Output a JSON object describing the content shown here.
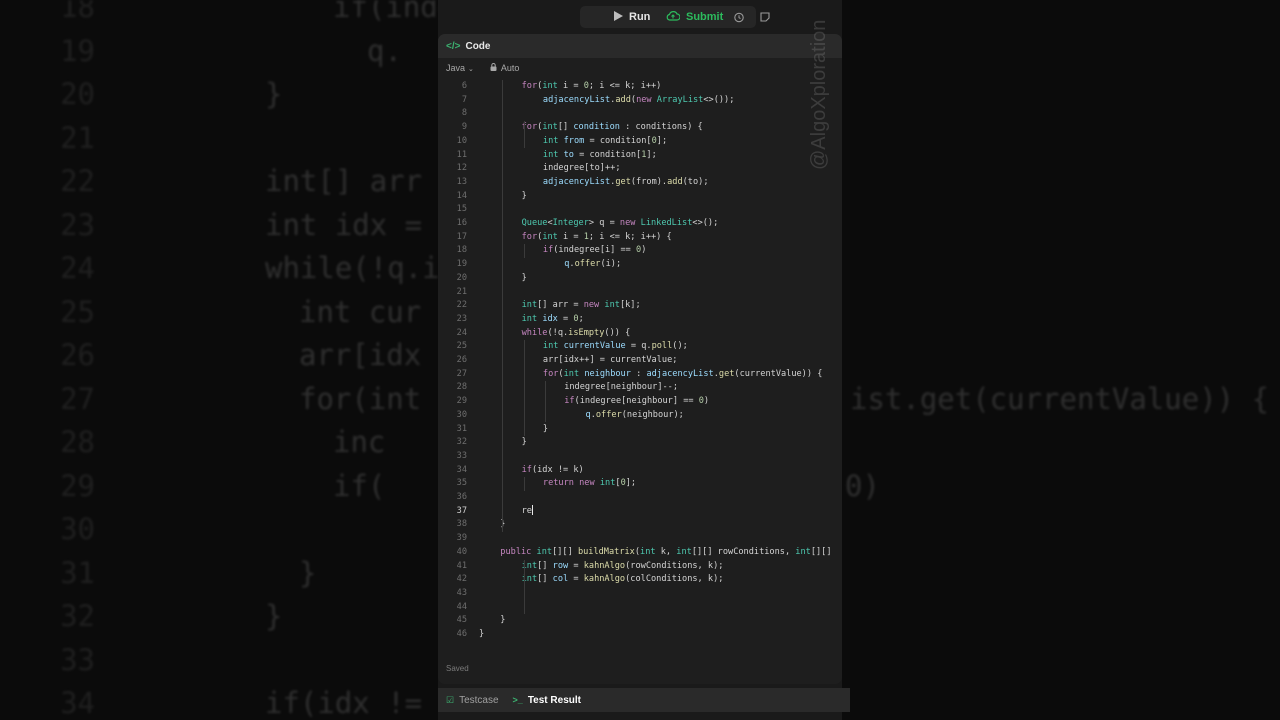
{
  "background": {
    "lines": [
      {
        "n": "18",
        "text": "if(inde"
      },
      {
        "n": "19",
        "text": "q."
      },
      {
        "n": "20",
        "text": "}"
      },
      {
        "n": "21",
        "text": ""
      },
      {
        "n": "22",
        "text": "int[] arr ="
      },
      {
        "n": "23",
        "text": "int idx = ("
      },
      {
        "n": "24",
        "text": "while(!q.is"
      },
      {
        "n": "25",
        "text": "int cur"
      },
      {
        "n": "26",
        "text": "arr[idx"
      },
      {
        "n": "27",
        "text": "for(int"
      },
      {
        "n": "28",
        "text": "inc"
      },
      {
        "n": "29",
        "text": "if("
      },
      {
        "n": "30",
        "text": ""
      },
      {
        "n": "31",
        "text": "}"
      },
      {
        "n": "32",
        "text": "}"
      },
      {
        "n": "33",
        "text": ""
      },
      {
        "n": "34",
        "text": "if(idx != k"
      }
    ],
    "right_fragments": [
      "ist.get(currentValue)) {",
      "0)"
    ]
  },
  "toolbar": {
    "run_label": "Run",
    "submit_label": "Submit",
    "icons": [
      "bug-icon",
      "play-icon",
      "cloud-upload-icon",
      "alarm-icon",
      "note-icon"
    ]
  },
  "panel": {
    "title": "Code",
    "language": "Java",
    "mode": "Auto",
    "saved_label": "Saved"
  },
  "code_lines": [
    {
      "n": "6",
      "indent": 2,
      "html": "<span class='kw'>for</span>(<span class='ty'>int</span> i = <span class='nm'>0</span>; i &lt;= k; i++)"
    },
    {
      "n": "7",
      "indent": 3,
      "html": "<span class='vr'>adjacencyList</span>.<span class='fn'>add</span>(<span class='kw'>new</span> <span class='ty'>ArrayList</span>&lt;&gt;());"
    },
    {
      "n": "8",
      "indent": 0,
      "html": ""
    },
    {
      "n": "9",
      "indent": 2,
      "html": "<span class='kw'>for</span>(<span class='ty'>int</span>[] <span class='vr'>condition</span> : conditions) {"
    },
    {
      "n": "10",
      "indent": 3,
      "html": "<span class='ty'>int</span> <span class='vr'>from</span> = condition[<span class='nm'>0</span>];"
    },
    {
      "n": "11",
      "indent": 3,
      "html": "<span class='ty'>int</span> <span class='vr'>to</span> = condition[<span class='nm'>1</span>];"
    },
    {
      "n": "12",
      "indent": 3,
      "html": "indegree[to]++;"
    },
    {
      "n": "13",
      "indent": 3,
      "html": "<span class='vr'>adjacencyList</span>.<span class='fn'>get</span>(from).<span class='fn'>add</span>(to);"
    },
    {
      "n": "14",
      "indent": 2,
      "html": "}"
    },
    {
      "n": "15",
      "indent": 0,
      "html": ""
    },
    {
      "n": "16",
      "indent": 2,
      "html": "<span class='ty'>Queue</span>&lt;<span class='ty'>Integer</span>&gt; q = <span class='kw'>new</span> <span class='ty'>LinkedList</span>&lt;&gt;();"
    },
    {
      "n": "17",
      "indent": 2,
      "html": "<span class='kw'>for</span>(<span class='ty'>int</span> i = <span class='nm'>1</span>; i &lt;= k; i++) {"
    },
    {
      "n": "18",
      "indent": 3,
      "html": "<span class='kw'>if</span>(indegree[i] == <span class='nm'>0</span>)"
    },
    {
      "n": "19",
      "indent": 4,
      "html": "<span class='vr'>q</span>.<span class='fn'>offer</span>(i);"
    },
    {
      "n": "20",
      "indent": 2,
      "html": "}"
    },
    {
      "n": "21",
      "indent": 0,
      "html": ""
    },
    {
      "n": "22",
      "indent": 2,
      "html": "<span class='ty'>int</span>[] arr = <span class='kw'>new</span> <span class='ty'>int</span>[k];"
    },
    {
      "n": "23",
      "indent": 2,
      "html": "<span class='ty'>int</span> <span class='vr'>idx</span> = <span class='nm'>0</span>;"
    },
    {
      "n": "24",
      "indent": 2,
      "html": "<span class='kw'>while</span>(!q.<span class='fn'>isEmpty</span>()) {"
    },
    {
      "n": "25",
      "indent": 3,
      "html": "<span class='ty'>int</span> <span class='vr'>currentValue</span> = q.<span class='fn'>poll</span>();"
    },
    {
      "n": "26",
      "indent": 3,
      "html": "arr[idx++] = currentValue;"
    },
    {
      "n": "27",
      "indent": 3,
      "html": "<span class='kw'>for</span>(<span class='ty'>int</span> <span class='vr'>neighbour</span> : <span class='vr'>adjacencyList</span>.<span class='fn'>get</span>(currentValue)) {"
    },
    {
      "n": "28",
      "indent": 4,
      "html": "indegree[neighbour]--;"
    },
    {
      "n": "29",
      "indent": 4,
      "html": "<span class='kw'>if</span>(indegree[neighbour] == <span class='nm'>0</span>)"
    },
    {
      "n": "30",
      "indent": 5,
      "html": "<span class='vr'>q</span>.<span class='fn'>offer</span>(neighbour);"
    },
    {
      "n": "31",
      "indent": 3,
      "html": "}"
    },
    {
      "n": "32",
      "indent": 2,
      "html": "}"
    },
    {
      "n": "33",
      "indent": 0,
      "html": ""
    },
    {
      "n": "34",
      "indent": 2,
      "html": "<span class='kw'>if</span>(idx != k)"
    },
    {
      "n": "35",
      "indent": 3,
      "html": "<span class='kw'>return</span> <span class='kw'>new</span> <span class='ty'>int</span>[<span class='nm'>0</span>];"
    },
    {
      "n": "36",
      "indent": 0,
      "html": ""
    },
    {
      "n": "37",
      "indent": 2,
      "html": "re<span class='caret'></span>",
      "current": true
    },
    {
      "n": "38",
      "indent": 1,
      "html": "}"
    },
    {
      "n": "39",
      "indent": 0,
      "html": ""
    },
    {
      "n": "40",
      "indent": 1,
      "html": "<span class='kw'>public</span> <span class='ty'>int</span>[][] <span class='fn'>buildMatrix</span>(<span class='ty'>int</span> k, <span class='ty'>int</span>[][] rowConditions, <span class='ty'>int</span>[][]"
    },
    {
      "n": "41",
      "indent": 2,
      "html": "<span class='ty'>int</span>[] <span class='vr'>row</span> = <span class='fn'>kahnAlgo</span>(rowConditions, k);"
    },
    {
      "n": "42",
      "indent": 2,
      "html": "<span class='ty'>int</span>[] <span class='vr'>col</span> = <span class='fn'>kahnAlgo</span>(colConditions, k);"
    },
    {
      "n": "43",
      "indent": 0,
      "html": ""
    },
    {
      "n": "44",
      "indent": 0,
      "html": ""
    },
    {
      "n": "45",
      "indent": 1,
      "html": "}"
    },
    {
      "n": "46",
      "indent": 0,
      "html": "}"
    }
  ],
  "bottom_tabs": [
    {
      "label": "Testcase",
      "icon": "check-square-icon",
      "active": false
    },
    {
      "label": "Test Result",
      "icon": "terminal-prompt-icon",
      "active": true
    }
  ],
  "watermark": "@AlgoXploration"
}
